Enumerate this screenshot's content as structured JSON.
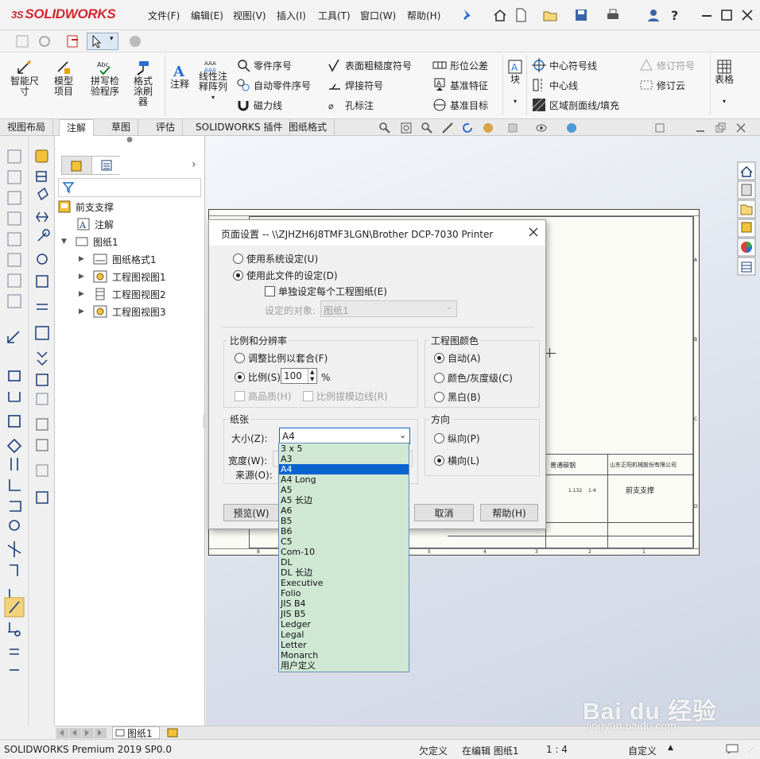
{
  "app": {
    "logo": "SOLIDWORKS",
    "logo_mark": "3S"
  },
  "menu": [
    "文件(F)",
    "编辑(E)",
    "视图(V)",
    "插入(I)",
    "工具(T)",
    "窗口(W)",
    "帮助(H)"
  ],
  "ribbon": {
    "smart_dim": "智能尺寸",
    "model_items": "模型项目",
    "spell_check": "拼写检验程序",
    "format_painter": "格式涂刷器",
    "note": "注释",
    "linear_note": "线性注释阵列",
    "balloon": "零件序号",
    "auto_balloon": "自动零件序号",
    "magnetic_line": "磁力线",
    "surface_finish": "表面粗糙度符号",
    "weld_symbol": "焊接符号",
    "hole_callout": "孔标注",
    "gtol": "形位公差",
    "datum_feature": "基准特征",
    "datum_target": "基准目标",
    "block": "块",
    "center_mark": "中心符号线",
    "centerline": "中心线",
    "area_hatch": "区域剖面线/填充",
    "revision_symbol": "修订符号",
    "revision_cloud": "修订云",
    "tables": "表格"
  },
  "tabs": [
    "视图布局",
    "注解",
    "草图",
    "评估",
    "SOLIDWORKS 插件",
    "图纸格式"
  ],
  "active_tab": 1,
  "tree": {
    "root": "前支支撑",
    "annotations": "注解",
    "sheet": "图纸1",
    "children": [
      "图纸格式1",
      "工程图视图1",
      "工程图视图2",
      "工程图视图3"
    ]
  },
  "dialog": {
    "title": "页面设置 -- \\\\ZJHZH6J8TMF3LGN\\Brother DCP-7030 Printer",
    "opt_system": "使用系统设定(U)",
    "opt_document": "使用此文件的设定(D)",
    "opt_each_sheet": "单独设定每个工程图纸(E)",
    "target_label": "设定的对象:",
    "target_value": "图纸1",
    "scale_group": "比例和分辨率",
    "fit": "调整比例以套合(F)",
    "scale": "比例(S):",
    "scale_value": "100",
    "percent": "%",
    "high_quality": "高品质(H)",
    "scale_line": "比例拔模边线(R)",
    "color_group": "工程图颜色",
    "color_auto": "自动(A)",
    "color_gray": "颜色/灰度级(C)",
    "color_bw": "黑白(B)",
    "paper_group": "纸张",
    "size_label": "大小(Z):",
    "size_value": "A4",
    "width_label": "宽度(W):",
    "source_label": "来源(O):",
    "orient_group": "方向",
    "portrait": "纵向(P)",
    "landscape": "横向(L)",
    "preview_btn": "预览(W)",
    "cancel_btn": "取消",
    "help_btn": "帮助(H)"
  },
  "paper_sizes": [
    "3 x 5",
    "A3",
    "A4",
    "A4 Long",
    "A5",
    "A5 长边",
    "A6",
    "B5",
    "B6",
    "C5",
    "Com-10",
    "DL",
    "DL 长边",
    "Executive",
    "Folio",
    "JIS B4",
    "JIS B5",
    "Ledger",
    "Legal",
    "Letter",
    "Monarch",
    "用户定义"
  ],
  "paper_selected": "A4",
  "drawing": {
    "title_block_a": "普通碳钢",
    "title_block_b": "山东正阳机械股份有限公司",
    "part_name": "前支支撑",
    "scale_a": "1.132",
    "scale_b": "1:4",
    "row_nums": [
      "1",
      "2",
      "3",
      "4",
      "5",
      "6",
      "7",
      "8"
    ],
    "letters": [
      "A",
      "B",
      "C",
      "D"
    ]
  },
  "sheet_tab": "图纸1",
  "status": {
    "product": "SOLIDWORKS Premium 2019 SP0.0",
    "under_defined": "欠定义",
    "editing": "在编辑 图纸1",
    "scale": "1 : 4",
    "custom": "自定义"
  },
  "watermark": {
    "main": "Bai du 经验",
    "sub": "jingyan.baidu.com"
  },
  "colors": {
    "brand_red": "#d3262e",
    "selection_blue": "#0a64d0",
    "dropdown_bg": "#cfe8d4"
  }
}
